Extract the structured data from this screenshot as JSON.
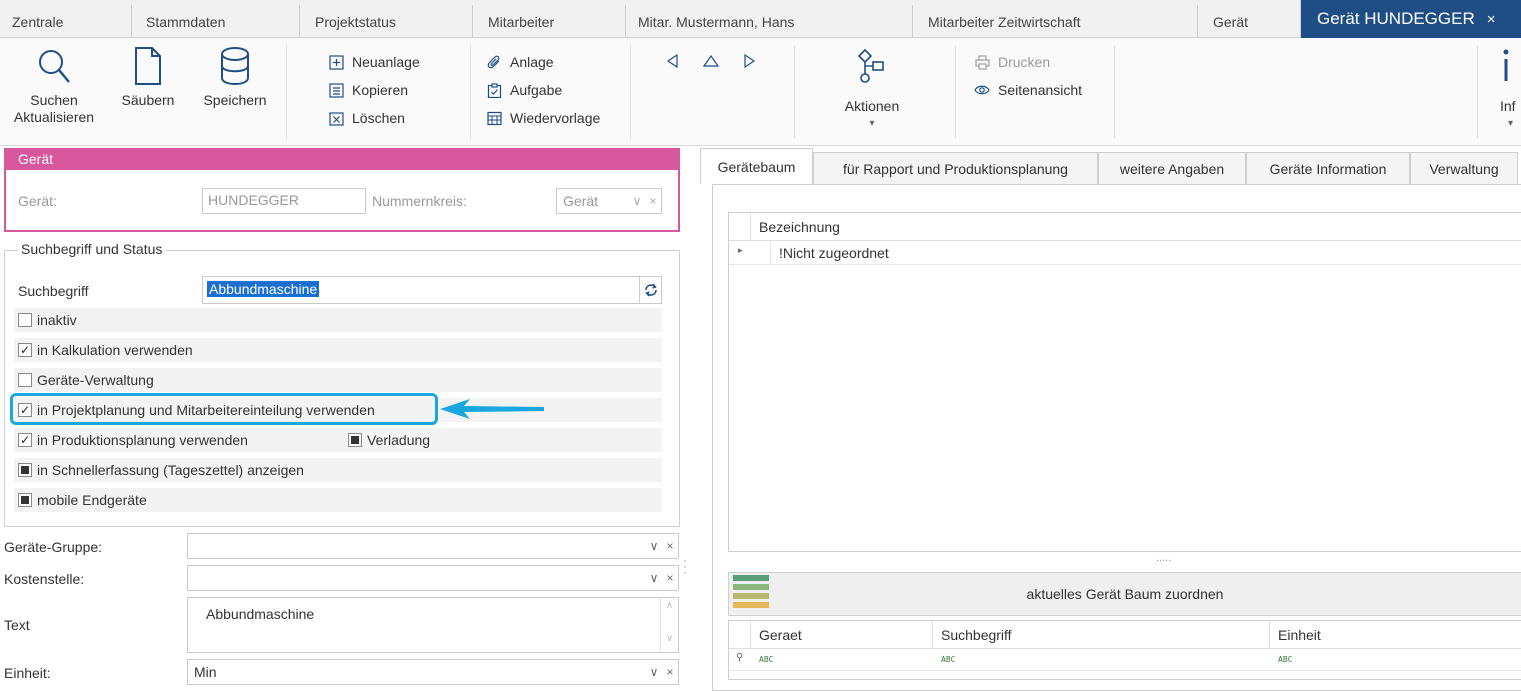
{
  "tabs": [
    "Zentrale",
    "Stammdaten",
    "Projektstatus",
    "Mitarbeiter",
    "Mitar. Mustermann, Hans",
    "Mitarbeiter Zeitwirtschaft",
    "Gerät",
    "Gerät HUNDEGGER"
  ],
  "tab_close": "×",
  "ribbon": {
    "suchen": "Suchen",
    "aktualisieren": "Aktualisieren",
    "saeubern": "Säubern",
    "speichern": "Speichern",
    "neuanlage": "Neuanlage",
    "kopieren": "Kopieren",
    "loeschen": "Löschen",
    "anlage": "Anlage",
    "aufgabe": "Aufgabe",
    "wiedervorlage": "Wiedervorlage",
    "aktionen": "Aktionen",
    "aktionen_arrow": "▾",
    "drucken": "Drucken",
    "seitenansicht": "Seitenansicht",
    "info": "Inf",
    "info_arrow": "▾"
  },
  "geraet_group": {
    "header": "Gerät",
    "geraet_label": "Gerät:",
    "geraet_value": "HUNDEGGER",
    "nummernkreis_label": "Nummernkreis:",
    "nummernkreis_value": "Gerät"
  },
  "such_group": {
    "legend": "Suchbegriff  und Status",
    "suchbegriff_label": "Suchbegriff",
    "suchbegriff_value": "Abbundmaschine",
    "checkboxes": [
      {
        "label": "inaktiv",
        "state": "unchecked"
      },
      {
        "label": "in Kalkulation verwenden",
        "state": "checked"
      },
      {
        "label": "Geräte-Verwaltung",
        "state": "unchecked"
      },
      {
        "label": "in Projektplanung und Mitarbeitereinteilung verwenden",
        "state": "checked"
      },
      {
        "label": "in Produktionsplanung verwenden",
        "state": "checked"
      },
      {
        "label": "in Schnellerfassung (Tageszettel) anzeigen",
        "state": "indeterminate"
      },
      {
        "label": "mobile Endgeräte",
        "state": "indeterminate"
      }
    ],
    "verladung_label": "Verladung",
    "verladung_state": "indeterminate"
  },
  "fields": {
    "gruppe_label": "Geräte-Gruppe:",
    "gruppe_value": "",
    "kostenstelle_label": "Kostenstelle:",
    "kostenstelle_value": "",
    "text_label": "Text",
    "text_value": "Abbundmaschine",
    "einheit_label": "Einheit:",
    "einheit_value": "Min"
  },
  "right_tabs": [
    "Gerätebaum",
    "für Rapport und Produktionsplanung",
    "weitere Angaben",
    "Geräte Information",
    "Verwaltung"
  ],
  "tree": {
    "header": "Bezeichnung",
    "rows": [
      "!Nicht zugeordnet"
    ],
    "splitter": "....."
  },
  "assign_button": "aktuelles Gerät Baum zuordnen",
  "grid2": {
    "columns": [
      "Geraet",
      "Suchbegriff",
      "Einheit"
    ],
    "filter_icon": "ABC"
  },
  "colors": {
    "tab_active": "#1f4e86",
    "group_header": "#d6579b",
    "highlight": "#1aa6df"
  }
}
